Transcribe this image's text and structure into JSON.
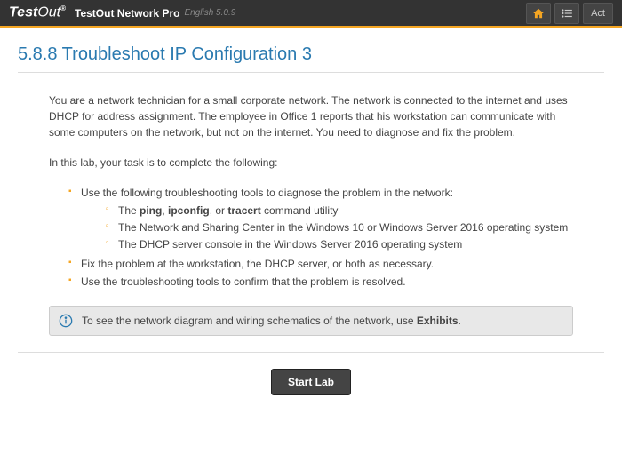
{
  "header": {
    "logo_test": "Test",
    "logo_out": "Out",
    "logo_reg": "®",
    "product": "TestOut Network Pro",
    "version": "English 5.0.9",
    "action_label": "Act"
  },
  "page": {
    "title": "5.8.8 Troubleshoot IP Configuration 3",
    "intro": "You are a network technician for a small corporate network. The network is connected to the internet and uses DHCP for address assignment. The employee in Office 1 reports that his workstation can communicate with some computers on the network, but not on the internet. You need to diagnose and fix the problem.",
    "task_intro": "In this lab, your task is to complete the following:",
    "li1_pre": "Use the following troubleshooting tools to diagnose the problem in the network:",
    "li1a_pre": "The ",
    "li1a_b1": "ping",
    "li1a_mid1": ", ",
    "li1a_b2": "ipconfig",
    "li1a_mid2": ", or ",
    "li1a_b3": "tracert",
    "li1a_post": " command utility",
    "li1b": "The Network and Sharing Center in the Windows 10 or Windows Server 2016 operating system",
    "li1c": "The DHCP server console in the Windows Server 2016 operating system",
    "li2": "Fix the problem at the workstation, the DHCP server, or both as necessary.",
    "li3": "Use the troubleshooting tools to confirm that the problem is resolved.",
    "info_pre": "To see the network diagram and wiring schematics of the network, use ",
    "info_b": "Exhibits",
    "info_post": ".",
    "start_label": "Start Lab"
  }
}
